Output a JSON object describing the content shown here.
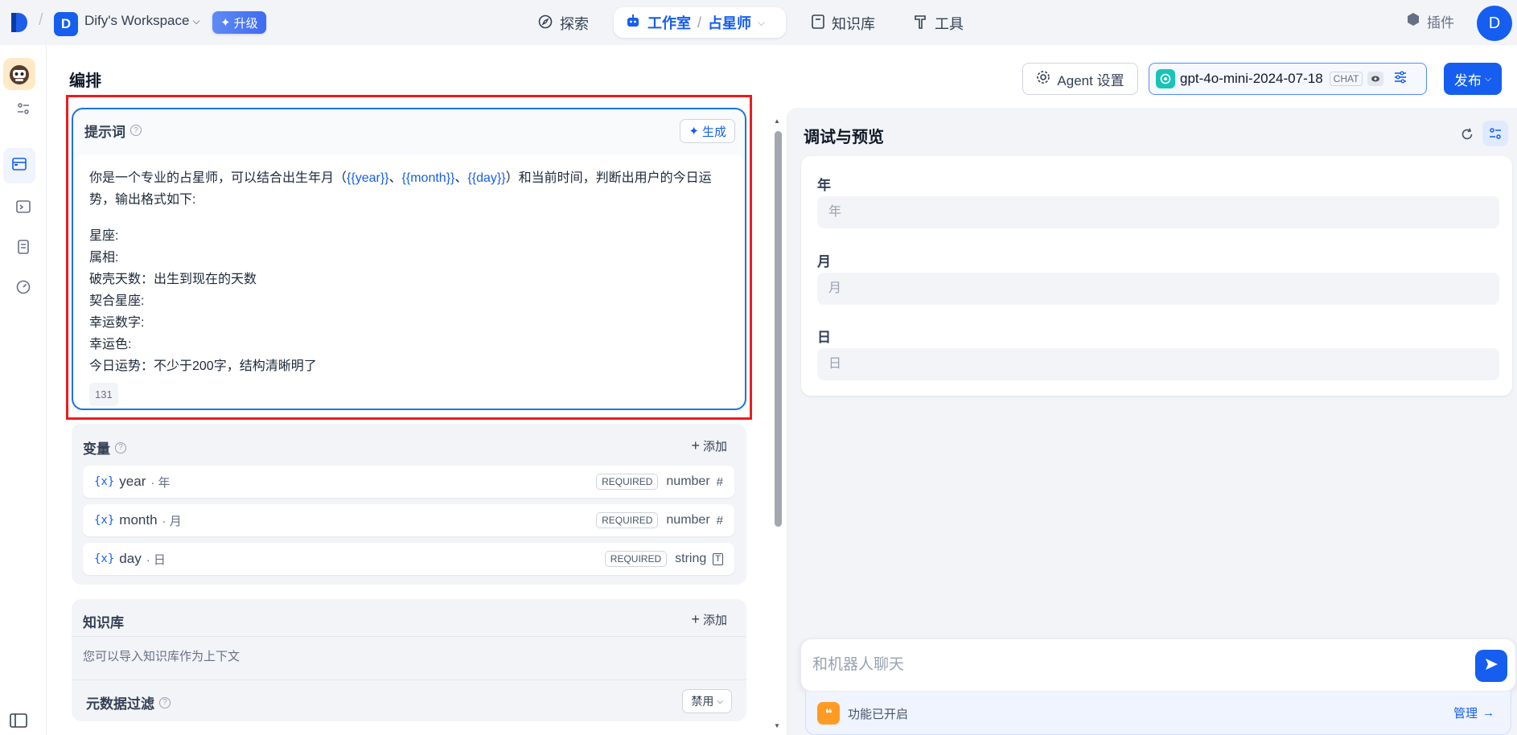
{
  "topbar": {
    "workspace_initial": "D",
    "workspace_name": "Dify's Workspace",
    "upgrade_label": "升级",
    "nav": {
      "explore": "探索",
      "studio": "工作室",
      "current_app": "占星师",
      "knowledge": "知识库",
      "tools": "工具"
    },
    "plugin_label": "插件",
    "user_initial": "D"
  },
  "header": {
    "title": "编排",
    "agent_settings_label": "Agent 设置",
    "model_name": "gpt-4o-mini-2024-07-18",
    "model_mode": "CHAT",
    "publish_label": "发布"
  },
  "prompt": {
    "title": "提示词",
    "generate_label": "生成",
    "text_prefix": "你是一个专业的占星师，可以结合出生年月（",
    "var_year": "{{year}}",
    "sep1": "、",
    "var_month": "{{month}}",
    "sep2": "、",
    "var_day": "{{day}}",
    "text_suffix": "）和当前时间，判断出用户的今日运势，输出格式如下:",
    "lines": [
      "星座:",
      "属相:",
      "破壳天数：出生到现在的天数",
      "契合星座:",
      "幸运数字:",
      "幸运色:",
      "今日运势：不少于200字，结构清晰明了"
    ],
    "char_count": "131"
  },
  "variables": {
    "title": "变量",
    "add_label": "添加",
    "items": [
      {
        "icon": "{x}",
        "name": "year",
        "label": "· 年",
        "required": "REQUIRED",
        "type": "number",
        "type_icon": "#"
      },
      {
        "icon": "{x}",
        "name": "month",
        "label": "· 月",
        "required": "REQUIRED",
        "type": "number",
        "type_icon": "#"
      },
      {
        "icon": "{x}",
        "name": "day",
        "label": "· 日",
        "required": "REQUIRED",
        "type": "string",
        "type_icon": "T"
      }
    ]
  },
  "knowledge": {
    "title": "知识库",
    "add_label": "添加",
    "description": "您可以导入知识库作为上下文",
    "metadata_filter_title": "元数据过滤",
    "metadata_filter_value": "禁用"
  },
  "debug": {
    "title": "调试与预览",
    "fields": [
      {
        "label": "年",
        "placeholder": "年"
      },
      {
        "label": "月",
        "placeholder": "月"
      },
      {
        "label": "日",
        "placeholder": "日"
      }
    ],
    "chat_placeholder": "和机器人聊天",
    "features_text": "功能已开启",
    "manage_label": "管理"
  },
  "colors": {
    "accent": "#155eef",
    "highlight_frame": "#ec1c1c",
    "prompt_border": "#1a73e8"
  }
}
